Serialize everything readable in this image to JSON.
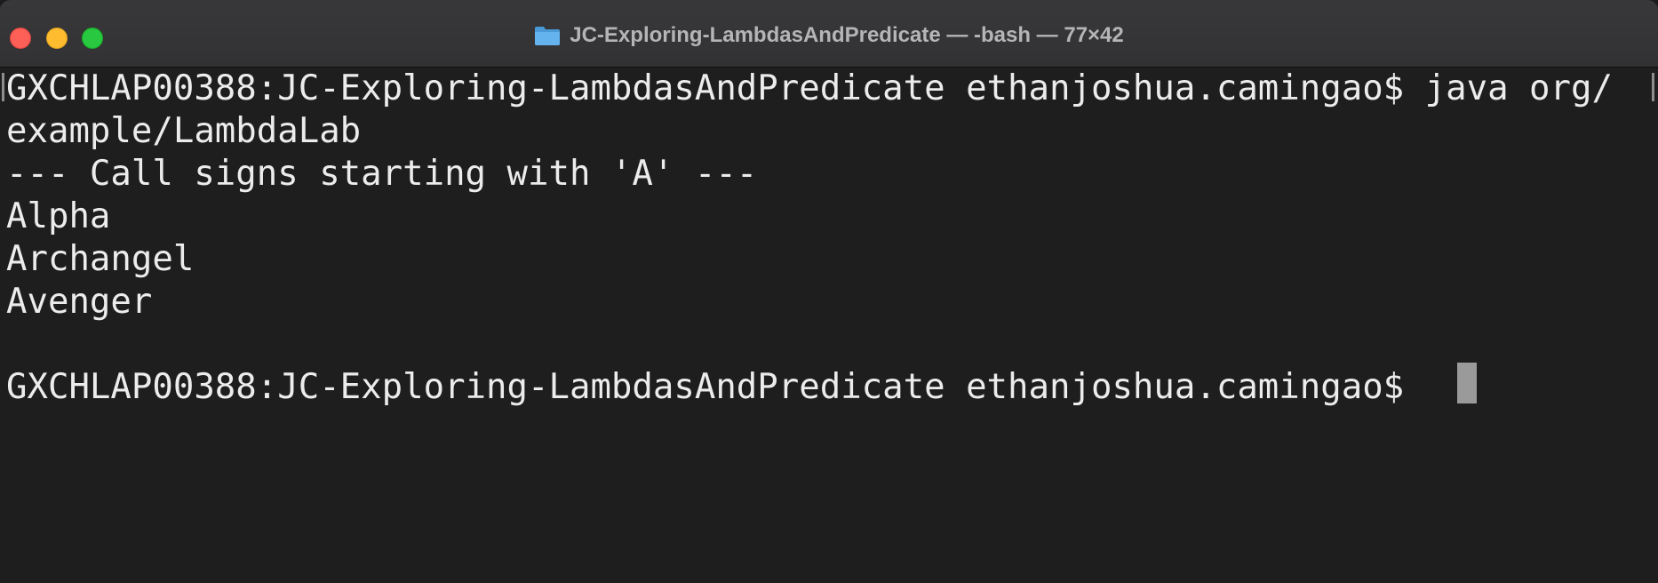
{
  "window": {
    "title": "JC-Exploring-LambdasAndPredicate — -bash — 77×42"
  },
  "terminal": {
    "lines": [
      "GXCHLAP00388:JC-Exploring-LambdasAndPredicate ethanjoshua.camingao$ java org/",
      "example/LambdaLab",
      "--- Call signs starting with 'A' ---",
      "Alpha",
      "Archangel",
      "Avenger",
      "",
      "GXCHLAP00388:JC-Exploring-LambdasAndPredicate ethanjoshua.camingao$ "
    ]
  },
  "icons": {
    "folder": "folder-icon",
    "close": "close-icon",
    "minimize": "minimize-icon",
    "maximize": "maximize-icon"
  },
  "colors": {
    "background": "#1e1e1e",
    "text": "#ececec",
    "titlebar": "#38383a",
    "close": "#fe5f57",
    "minimize": "#febc2e",
    "maximize": "#28c840",
    "folder": "#5aa9e6"
  }
}
